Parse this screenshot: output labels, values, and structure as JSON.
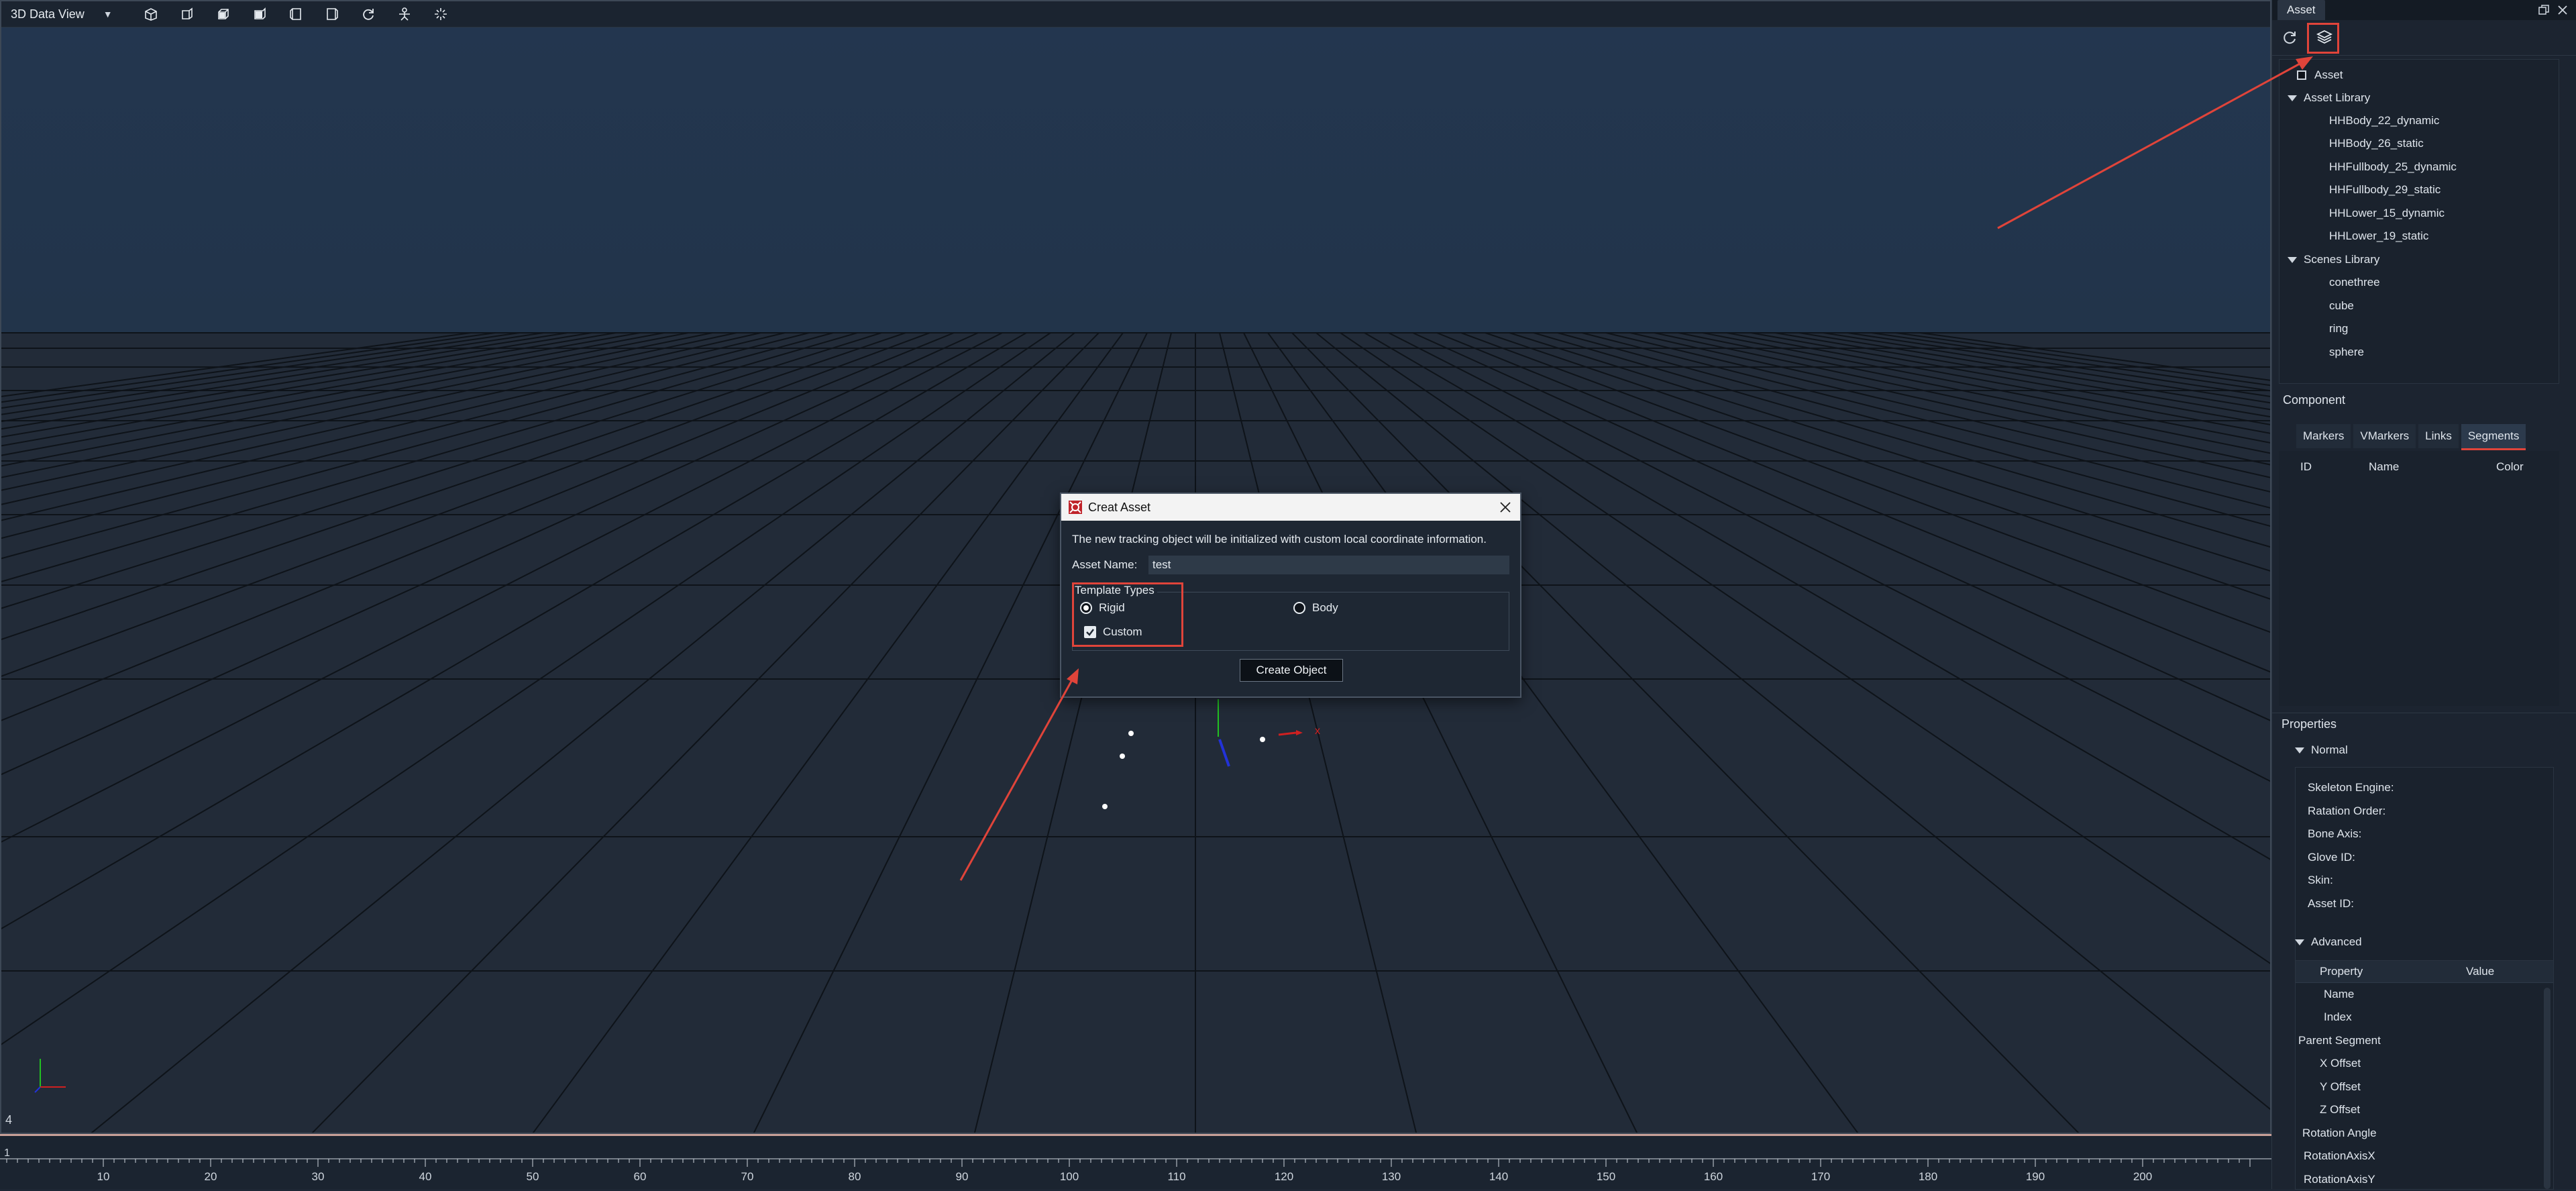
{
  "viewport": {
    "view_mode": "3D Data View",
    "corner_label": "4",
    "toolbar_icons": [
      "view-front-icon",
      "view-side-icon",
      "view-top-icon",
      "view-back-icon",
      "view-left-icon",
      "view-right-icon",
      "refresh-view-icon",
      "rig-icon",
      "snap-icon"
    ],
    "axis_label_x": "x"
  },
  "timeline": {
    "start_label": "1",
    "ticks": [
      10,
      20,
      30,
      40,
      50,
      60,
      70,
      80,
      90,
      100,
      110,
      120,
      130,
      140,
      150,
      160,
      170,
      180,
      190,
      200
    ]
  },
  "dock": {
    "tab": "Asset",
    "tree": {
      "root": "Asset",
      "groups": [
        {
          "label": "Asset Library",
          "items": [
            "HHBody_22_dynamic",
            "HHBody_26_static",
            "HHFullbody_25_dynamic",
            "HHFullbody_29_static",
            "HHLower_15_dynamic",
            "HHLower_19_static"
          ]
        },
        {
          "label": "Scenes Library",
          "items": [
            "conethree",
            "cube",
            "ring",
            "sphere"
          ]
        }
      ]
    },
    "component": {
      "title": "Component",
      "tabs": [
        "Markers",
        "VMarkers",
        "Links",
        "Segments"
      ],
      "active_tab": "Segments",
      "columns": [
        "ID",
        "Name",
        "Color"
      ]
    },
    "properties": {
      "title": "Properties",
      "normal_title": "Normal",
      "normal_rows": [
        "Skeleton Engine:",
        "Ratation Order:",
        "Bone Axis:",
        "Glove ID:",
        "Skin:",
        "Asset ID:"
      ],
      "advanced_title": "Advanced",
      "advanced_columns": [
        "Property",
        "Value"
      ],
      "advanced_rows": [
        "Name",
        "Index",
        "Parent Segment",
        "X Offset",
        "Y Offset",
        "Z Offset",
        "Rotation Angle",
        "RotationAxisX",
        "RotationAxisY"
      ]
    }
  },
  "dialog": {
    "title": "Creat Asset",
    "description": "The new tracking object will be initialized with custom local coordinate information.",
    "name_label": "Asset Name:",
    "name_value": "test",
    "template_legend": "Template Types",
    "radio_rigid": "Rigid",
    "radio_body": "Body",
    "selected": "Rigid",
    "custom_label": "Custom",
    "custom_checked": true,
    "create_button": "Create Object"
  },
  "colors": {
    "highlight": "#e0443a",
    "background": "#212b38",
    "panel": "#1c2430"
  }
}
